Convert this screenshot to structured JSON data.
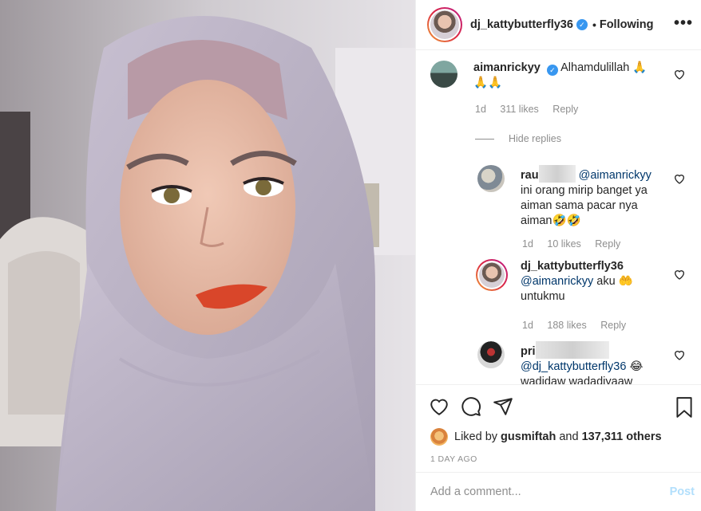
{
  "post": {
    "username": "dj_kattybutterfly36",
    "separator": "•",
    "follow_status": "Following",
    "more": "•••"
  },
  "comments": [
    {
      "username": "aimanrickyy",
      "text": "Alhamdulillah 🙏",
      "text2": "🙏🙏",
      "time": "1d",
      "likes": "311 likes",
      "reply": "Reply",
      "verified": true
    },
    {
      "username": "rau",
      "mention": "@aimanrickyy",
      "text": "ini orang mirip banget ya",
      "text2": "aiman sama pacar nya",
      "text3": "aiman🤣🤣",
      "time": "1d",
      "likes": "10 likes",
      "reply": "Reply"
    },
    {
      "username": "dj_kattybutterfly36",
      "mention": "@aimanrickyy",
      "text": "aku 🤲",
      "text2": "untukmu",
      "time": "1d",
      "likes": "188 likes",
      "reply": "Reply"
    },
    {
      "username": "pri",
      "mention": "@dj_kattybutterfly36",
      "text": "😂",
      "text2": "wadidaw wadadiyaaw"
    }
  ],
  "hide_replies": "Hide replies",
  "likes": {
    "prefix": "Liked by",
    "user": "gusmiftah",
    "and": "and",
    "others": "137,311 others"
  },
  "date": "1 DAY AGO",
  "add_comment": {
    "placeholder": "Add a comment...",
    "post_label": "Post"
  },
  "colors": {
    "link": "#00376b",
    "verified": "#3897f0",
    "post_disabled": "#b2dffc",
    "muted": "#8e8e8e"
  },
  "icons": [
    "heart-icon",
    "comment-icon",
    "share-icon",
    "save-icon",
    "verified-icon",
    "more-icon"
  ]
}
